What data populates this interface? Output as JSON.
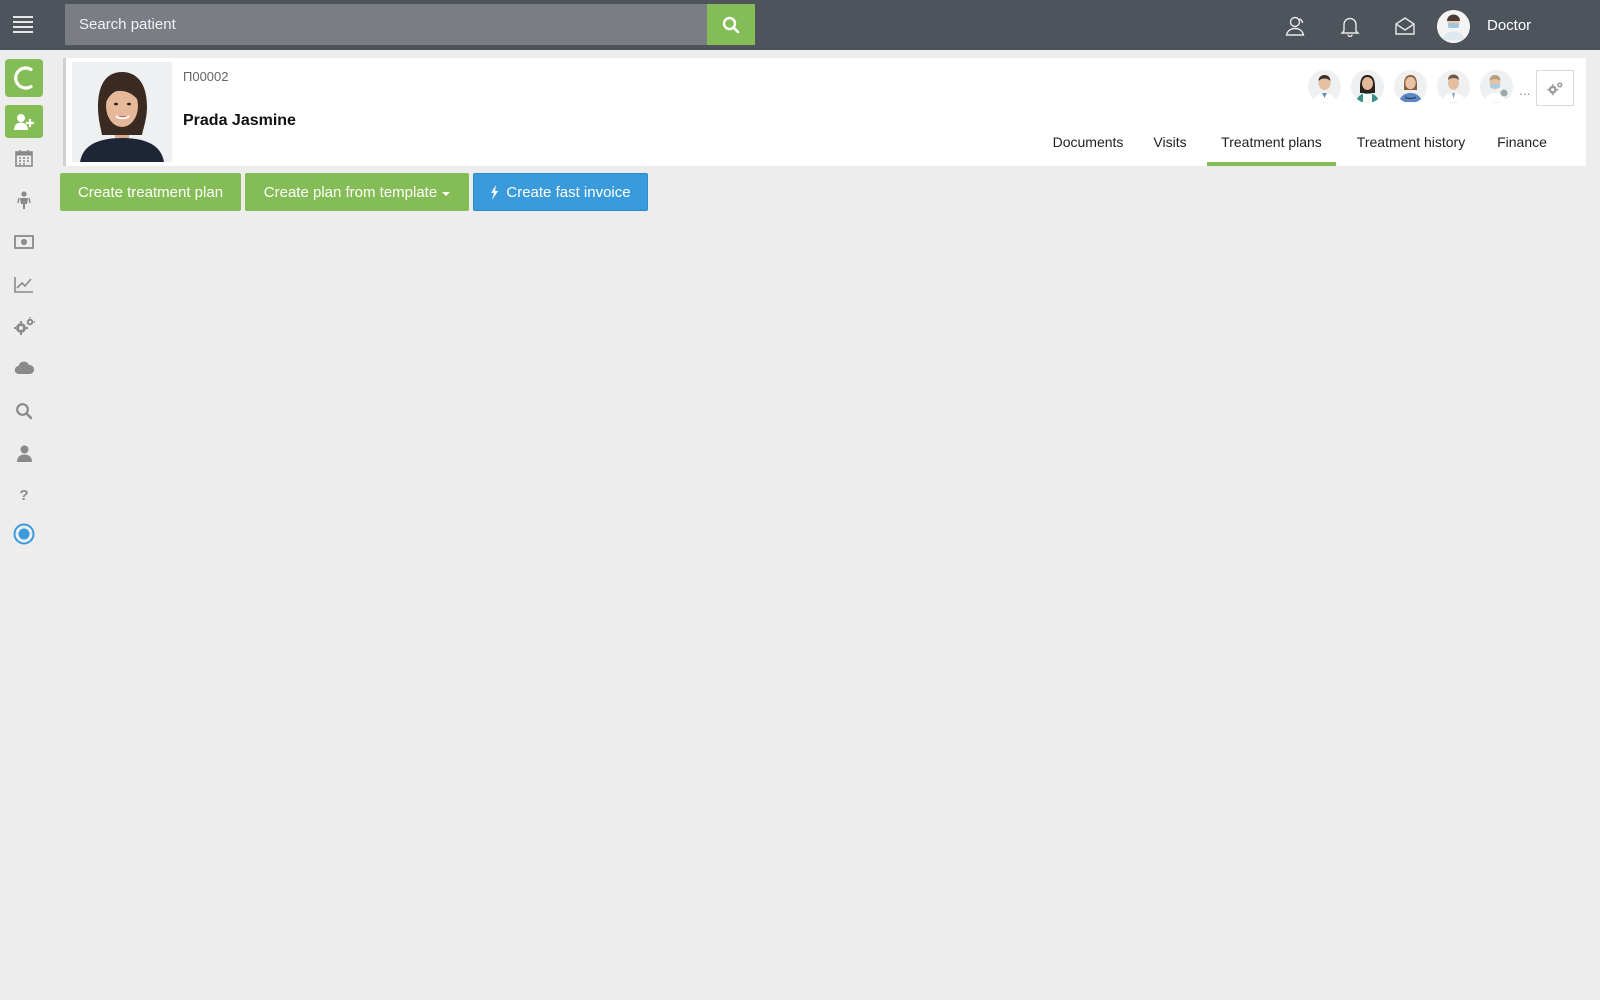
{
  "topbar": {
    "search_placeholder": "Search patient",
    "user_name": "Doctor",
    "icons": [
      "menu-icon",
      "search-icon",
      "users-icon",
      "bell-icon",
      "mail-icon"
    ]
  },
  "sidebar": {
    "logo_letter": "C",
    "items": [
      {
        "name": "add-patient",
        "icon": "user-plus-icon"
      },
      {
        "name": "calendar",
        "icon": "calendar-icon"
      },
      {
        "name": "patients",
        "icon": "person-icon"
      },
      {
        "name": "finance",
        "icon": "money-icon"
      },
      {
        "name": "reports",
        "icon": "chart-line-icon"
      },
      {
        "name": "settings",
        "icon": "gears-icon"
      },
      {
        "name": "cloud",
        "icon": "cloud-icon"
      },
      {
        "name": "search",
        "icon": "search-icon"
      },
      {
        "name": "profile",
        "icon": "user-icon"
      },
      {
        "name": "help",
        "icon": "question-icon",
        "label": "?"
      },
      {
        "name": "status",
        "icon": "radio-dot-icon"
      }
    ]
  },
  "patient": {
    "id": "П00002",
    "name": "Prada Jasmine"
  },
  "doctors_more": "...",
  "tabs": [
    {
      "label": "Documents",
      "active": false
    },
    {
      "label": "Visits",
      "active": false
    },
    {
      "label": "Treatment plans",
      "active": true
    },
    {
      "label": "Treatment history",
      "active": false
    },
    {
      "label": "Finance",
      "active": false
    }
  ],
  "actions": {
    "create_plan": "Create treatment plan",
    "create_from_template": "Create plan from template",
    "fast_invoice": "Create fast invoice"
  },
  "colors": {
    "accent_green": "#84bc55",
    "accent_blue": "#3a9bdc",
    "topbar": "#4e545c",
    "background": "#ededed"
  }
}
